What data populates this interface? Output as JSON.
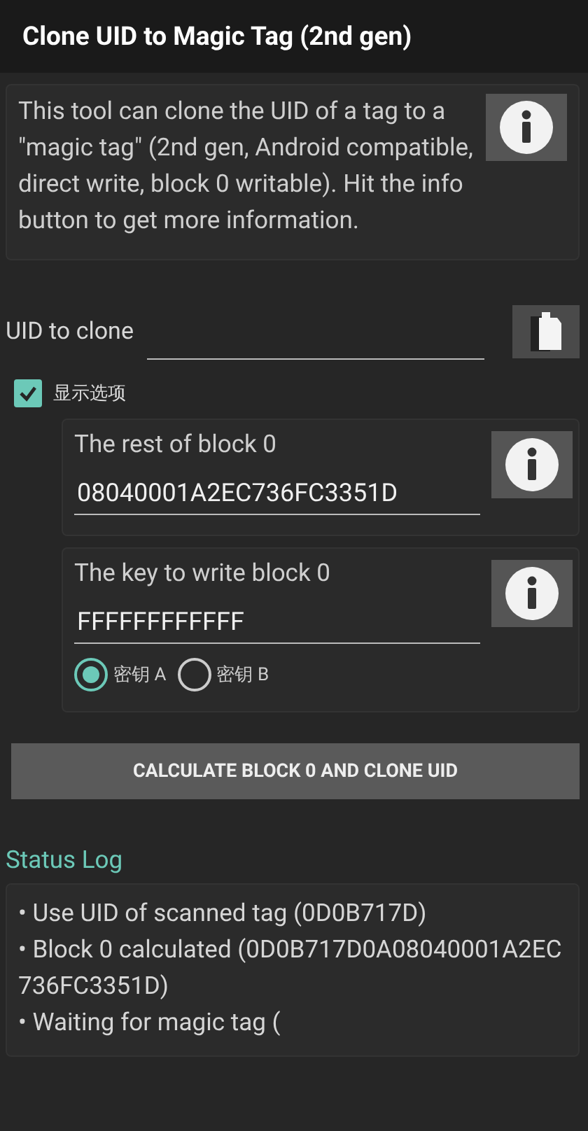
{
  "title": "Clone UID to Magic Tag (2nd gen)",
  "description": "This tool can clone the UID of a tag to a \"magic tag\" (2nd gen, Android compatible, direct write, block 0 writable). Hit the info button to get more information.",
  "uid_field": {
    "label": "UID to clone"
  },
  "show_options": {
    "label": "显示选项",
    "checked": true
  },
  "options": [
    {
      "label": "The rest of block 0",
      "value": "08040001A2EC736FC3351D"
    },
    {
      "label": "The key to write block 0",
      "value": "FFFFFFFFFFFF",
      "radios": [
        {
          "label": "密钥 A",
          "selected": true
        },
        {
          "label": "密钥 B",
          "selected": false
        }
      ]
    }
  ],
  "action_button": "CALCULATE BLOCK 0 AND CLONE UID",
  "status_log": {
    "title": "Status Log",
    "lines": [
      "• Use UID of scanned tag (0D0B717D)",
      "• Block 0 calculated (0D0B717D0A08040001A2EC736FC3351D)",
      "• Waiting for magic tag ("
    ]
  }
}
